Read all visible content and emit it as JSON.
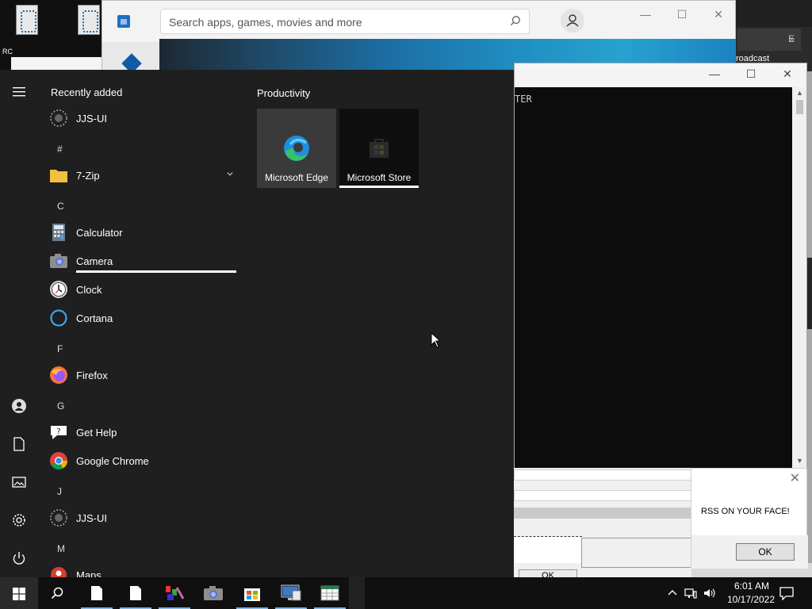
{
  "desktop": {
    "icon_label": "RC"
  },
  "store": {
    "search_placeholder": "Search apps, games, movies and more",
    "minimize": "—",
    "maximize": "☐",
    "close": "✕"
  },
  "bg_right": {
    "tab_letter": "E",
    "tab_more": "»",
    "broadcast_text": "roadcast"
  },
  "terminal": {
    "text": "TER",
    "minimize": "—",
    "maximize": "☐",
    "close": "✕",
    "scroll_up": "▲",
    "scroll_down": "▼"
  },
  "dialogs": {
    "left_ok": "OK",
    "rss_message": "RSS ON YOUR FACE!",
    "rss_ok": "OK",
    "rss_close": "✕"
  },
  "start_menu": {
    "recently_added_heading": "Recently added",
    "recent_items": [
      {
        "label": "JJS-UI",
        "icon": "jjs-ui-icon"
      }
    ],
    "groups": [
      {
        "letter": "#",
        "items": [
          {
            "label": "7-Zip",
            "icon": "folder-icon",
            "expandable": true
          }
        ]
      },
      {
        "letter": "C",
        "items": [
          {
            "label": "Calculator",
            "icon": "calculator-icon"
          },
          {
            "label": "Camera",
            "icon": "camera-icon"
          },
          {
            "label": "Clock",
            "icon": "clock-icon"
          },
          {
            "label": "Cortana",
            "icon": "cortana-icon"
          }
        ]
      },
      {
        "letter": "F",
        "items": [
          {
            "label": "Firefox",
            "icon": "firefox-icon"
          }
        ]
      },
      {
        "letter": "G",
        "items": [
          {
            "label": "Get Help",
            "icon": "get-help-icon"
          },
          {
            "label": "Google Chrome",
            "icon": "chrome-icon"
          }
        ]
      },
      {
        "letter": "J",
        "items": [
          {
            "label": "JJS-UI",
            "icon": "jjs-ui-icon"
          }
        ]
      },
      {
        "letter": "M",
        "items": [
          {
            "label": "Maps",
            "icon": "maps-icon"
          }
        ]
      }
    ],
    "tiles_heading": "Productivity",
    "tiles": [
      {
        "label": "Microsoft Edge",
        "icon": "edge-icon"
      },
      {
        "label": "Microsoft Store",
        "icon": "store-icon"
      }
    ],
    "rail_icons": [
      "hamburger-menu-icon",
      "user-account-icon",
      "documents-icon",
      "pictures-icon",
      "settings-gear-icon",
      "power-icon"
    ]
  },
  "taskbar": {
    "apps": [
      "file-icon",
      "file-icon",
      "paint-app-icon",
      "camera-icon",
      "store-icon",
      "monitor-app-icon",
      "spreadsheet-app-icon"
    ],
    "time": "6:01 AM",
    "date": "10/17/2022"
  },
  "colors": {
    "start_bg": "#1f1f1f",
    "taskbar_bg": "#101010",
    "accent_underline": "#7fb4e6"
  }
}
